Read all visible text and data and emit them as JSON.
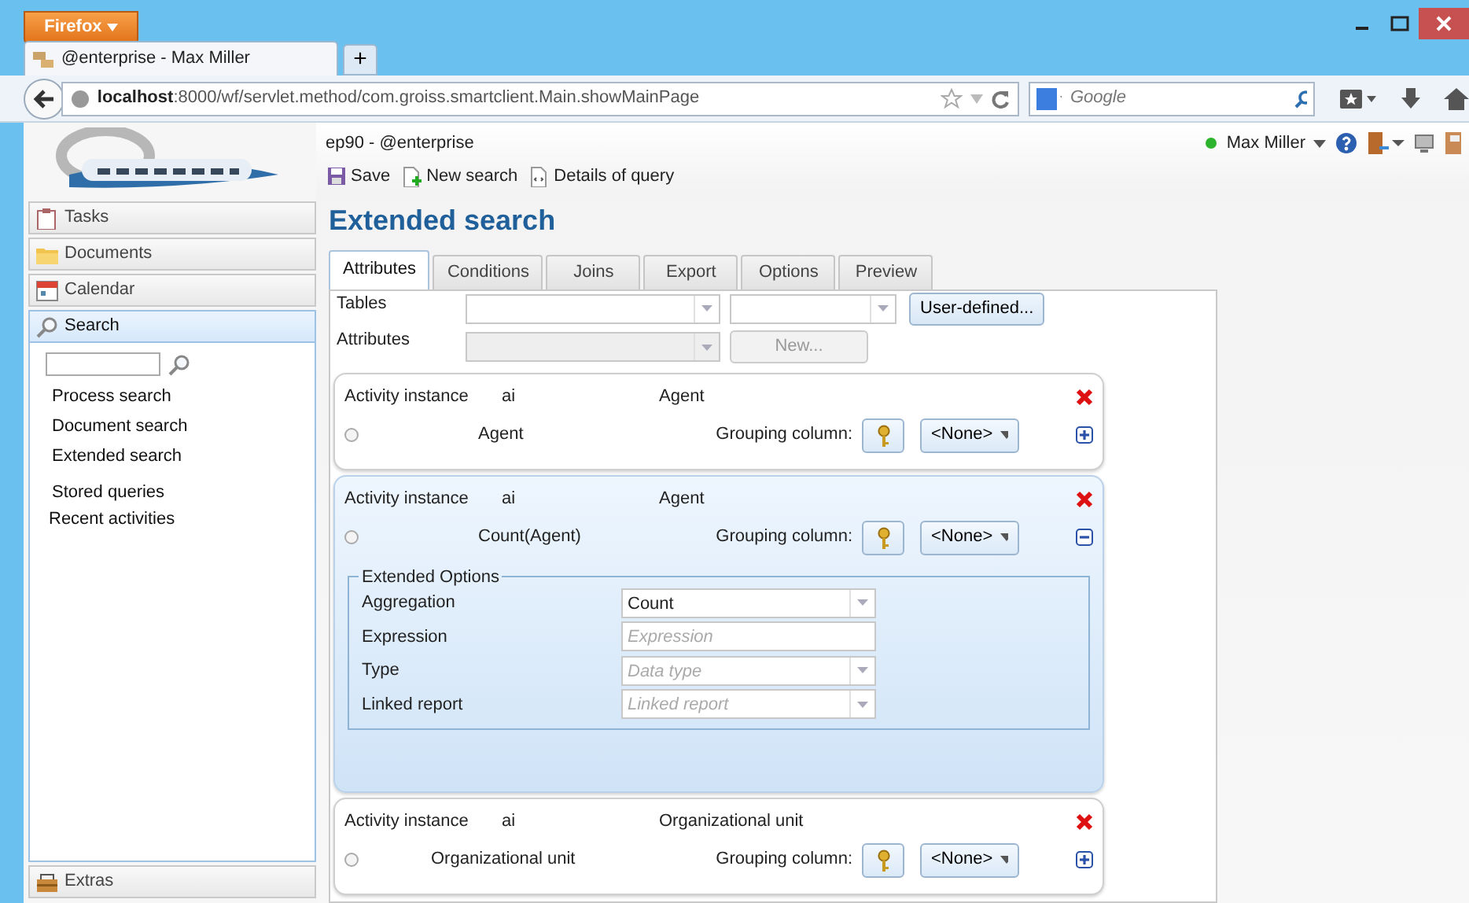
{
  "browser": {
    "menu_button": "Firefox",
    "tab_title": "@enterprise - Max Miller",
    "new_tab": "+",
    "url_host": "localhost",
    "url_rest": ":8000/wf/servlet.method/com.groiss.smartclient.Main.showMainPage",
    "search_placeholder": "Google"
  },
  "app": {
    "header_title": "ep90 - @enterprise",
    "toolbar": [
      {
        "label": "Save"
      },
      {
        "label": "New search"
      },
      {
        "label": "Details of query"
      }
    ],
    "user": {
      "name": "Max Miller",
      "online": true
    }
  },
  "sidebar": {
    "sections": [
      {
        "label": "Tasks",
        "expanded": false
      },
      {
        "label": "Documents",
        "expanded": false
      },
      {
        "label": "Calendar",
        "expanded": false
      },
      {
        "label": "Search",
        "expanded": true,
        "items": [
          "Process search",
          "Document search",
          "Extended search",
          "Stored queries",
          "Recent activities"
        ]
      },
      {
        "label": "Extras",
        "expanded": false
      }
    ]
  },
  "page_title": "Extended search",
  "tabs": [
    {
      "label": "Attributes",
      "selected": true
    },
    {
      "label": "Conditions",
      "selected": false
    },
    {
      "label": "Joins",
      "selected": false
    },
    {
      "label": "Export",
      "selected": false
    },
    {
      "label": "Options",
      "selected": false
    },
    {
      "label": "Preview",
      "selected": false
    }
  ],
  "form": {
    "tables_label": "Tables",
    "attributes_label": "Attributes",
    "attributes_disabled": true,
    "user_defined_button": "User-defined...",
    "new_button": "New...",
    "new_disabled": true
  },
  "attributes": [
    {
      "table": "Activity instance",
      "alias": "ai",
      "column": "Agent",
      "name": "Agent",
      "grouping_label": "Grouping column:",
      "grouping_value": "<None>",
      "checked": false,
      "selected": false,
      "expanded": false
    },
    {
      "table": "Activity instance",
      "alias": "ai",
      "column": "Agent",
      "name": "Count(Agent)",
      "grouping_label": "Grouping column:",
      "grouping_value": "<None>",
      "checked": false,
      "selected": true,
      "expanded": true,
      "options": {
        "legend": "Extended Options",
        "fields": [
          {
            "label": "Aggregation",
            "kind": "select",
            "value": "Count"
          },
          {
            "label": "Expression",
            "kind": "text",
            "placeholder": "Expression"
          },
          {
            "label": "Type",
            "kind": "select",
            "placeholder": "Data type"
          },
          {
            "label": "Linked report",
            "kind": "select",
            "placeholder": "Linked report"
          }
        ]
      }
    },
    {
      "table": "Activity instance",
      "alias": "ai",
      "column": "Organizational unit",
      "name": "Organizational unit",
      "grouping_label": "Grouping column:",
      "grouping_value": "<None>",
      "checked": false,
      "selected": false,
      "expanded": false
    }
  ]
}
